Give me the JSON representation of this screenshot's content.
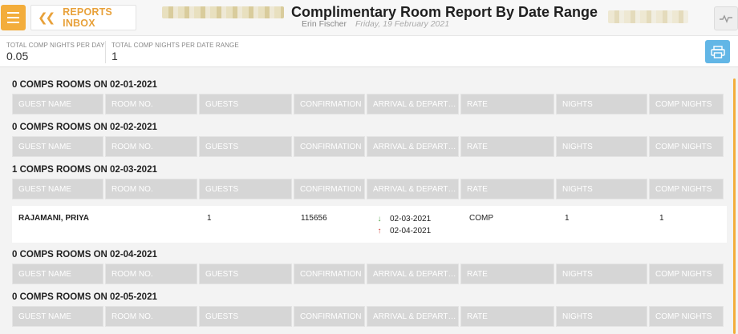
{
  "header": {
    "menu_icon": "hamburger-icon",
    "back_label": "REPORTS INBOX",
    "title": "Complimentary Room Report By Date Range",
    "user": "Erin Fischer",
    "date": "Friday, 19 February 2021",
    "activity_icon": "pulse-icon",
    "accent_color": "#f3ad3b"
  },
  "summary": {
    "per_day_caption": "TOTAL COMP NIGHTS PER DAY",
    "per_day_value": "0.05",
    "range_caption": "TOTAL COMP NIGHTS PER DATE RANGE",
    "range_value": "1",
    "print_icon": "printer-icon",
    "print_color": "#62b6e6"
  },
  "columns": [
    "GUEST NAME",
    "ROOM NO.",
    "GUESTS",
    "CONFIRMATION",
    "ARRIVAL & DEPART…",
    "RATE",
    "NIGHTS",
    "COMP NIGHTS"
  ],
  "sections": [
    {
      "title": "0 COMPS ROOMS ON 02-01-2021"
    },
    {
      "title": "0 COMPS ROOMS ON 02-02-2021"
    },
    {
      "title": "1 COMPS ROOMS ON 02-03-2021",
      "rows": [
        {
          "guest_name": "RAJAMANI, PRIYA",
          "room_no": "",
          "guests": "1",
          "confirmation": "115656",
          "arrival": "02-03-2021",
          "departure": "02-04-2021",
          "rate": "COMP",
          "nights": "1",
          "comp_nights": "1"
        }
      ]
    },
    {
      "title": "0 COMPS ROOMS ON 02-04-2021"
    },
    {
      "title": "0 COMPS ROOMS ON 02-05-2021"
    }
  ]
}
